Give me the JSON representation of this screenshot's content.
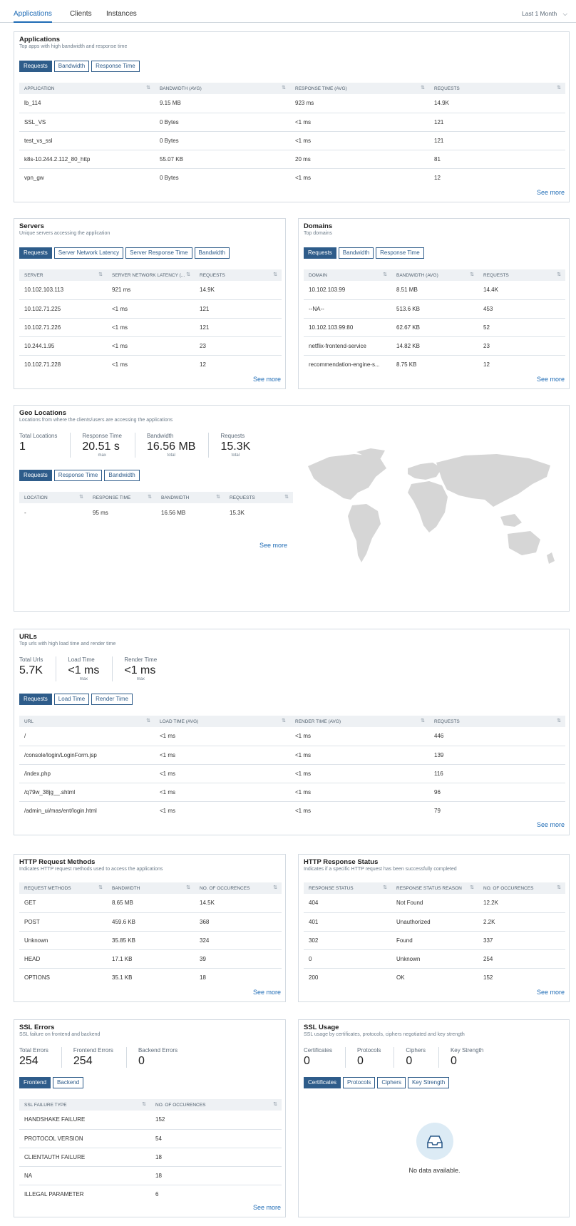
{
  "topnav": {
    "tabs": [
      "Applications",
      "Clients",
      "Instances"
    ],
    "period": "Last 1 Month"
  },
  "applications": {
    "title": "Applications",
    "subtitle": "Top apps with high bandwidth and response time",
    "buttons": [
      "Requests",
      "Bandwidth",
      "Response Time"
    ],
    "headers": [
      "APPLICATION",
      "BANDWIDTH (AVG)",
      "RESPONSE TIME (AVG)",
      "REQUESTS"
    ],
    "rows": [
      [
        "lb_114",
        "9.15 MB",
        "923 ms",
        "14.9K"
      ],
      [
        "SSL_VS",
        "0 Bytes",
        "<1 ms",
        "121"
      ],
      [
        "test_vs_ssl",
        "0 Bytes",
        "<1 ms",
        "121"
      ],
      [
        "k8s-10.244.2.112_80_http",
        "55.07 KB",
        "20 ms",
        "81"
      ],
      [
        "vpn_gw",
        "0 Bytes",
        "<1 ms",
        "12"
      ]
    ],
    "see_more": "See more"
  },
  "servers": {
    "title": "Servers",
    "subtitle": "Unique servers accessing the application",
    "buttons": [
      "Requests",
      "Server Network Latency",
      "Server Response Time",
      "Bandwidth"
    ],
    "headers": [
      "SERVER",
      "SERVER NETWORK LATENCY (...",
      "REQUESTS"
    ],
    "rows": [
      [
        "10.102.103.113",
        "921 ms",
        "14.9K"
      ],
      [
        "10.102.71.225",
        "<1 ms",
        "121"
      ],
      [
        "10.102.71.226",
        "<1 ms",
        "121"
      ],
      [
        "10.244.1.95",
        "<1 ms",
        "23"
      ],
      [
        "10.102.71.228",
        "<1 ms",
        "12"
      ]
    ],
    "see_more": "See more"
  },
  "domains": {
    "title": "Domains",
    "subtitle": "Top domains",
    "buttons": [
      "Requests",
      "Bandwidth",
      "Response Time"
    ],
    "headers": [
      "DOMAIN",
      "BANDWIDTH (AVG)",
      "REQUESTS"
    ],
    "rows": [
      [
        "10.102.103.99",
        "8.51 MB",
        "14.4K"
      ],
      [
        "--NA--",
        "513.6 KB",
        "453"
      ],
      [
        "10.102.103.99:80",
        "62.67 KB",
        "52"
      ],
      [
        "netflix-frontend-service",
        "14.82 KB",
        "23"
      ],
      [
        "recommendation-engine-s...",
        "8.75 KB",
        "12"
      ]
    ],
    "see_more": "See more"
  },
  "geo": {
    "title": "Geo Locations",
    "subtitle": "Locations from where the clients/users are accessing the applications",
    "stats": [
      {
        "label": "Total Locations",
        "value": "1",
        "sub": ""
      },
      {
        "label": "Response Time",
        "value": "20.51 s",
        "sub": "max"
      },
      {
        "label": "Bandwidth",
        "value": "16.56 MB",
        "sub": "total"
      },
      {
        "label": "Requests",
        "value": "15.3K",
        "sub": "total"
      }
    ],
    "buttons": [
      "Requests",
      "Response Time",
      "Bandwidth"
    ],
    "headers": [
      "LOCATION",
      "RESPONSE TIME",
      "BANDWIDTH",
      "REQUESTS"
    ],
    "rows": [
      [
        "-",
        "95 ms",
        "16.56 MB",
        "15.3K"
      ]
    ],
    "see_more": "See more",
    "map_color": "#d6d6d6"
  },
  "urls": {
    "title": "URLs",
    "subtitle": "Top urls with high load time and render time",
    "stats": [
      {
        "label": "Total Urls",
        "value": "5.7K",
        "sub": ""
      },
      {
        "label": "Load Time",
        "value": "<1 ms",
        "sub": "max"
      },
      {
        "label": "Render Time",
        "value": "<1 ms",
        "sub": "max"
      }
    ],
    "buttons": [
      "Requests",
      "Load Time",
      "Render Time"
    ],
    "headers": [
      "URL",
      "LOAD TIME (AVG)",
      "RENDER TIME (AVG)",
      "REQUESTS"
    ],
    "rows": [
      [
        "/",
        "<1 ms",
        "<1 ms",
        "446"
      ],
      [
        "/console/login/LoginForm.jsp",
        "<1 ms",
        "<1 ms",
        "139"
      ],
      [
        "/index.php",
        "<1 ms",
        "<1 ms",
        "116"
      ],
      [
        "/q79w_38jg__.shtml",
        "<1 ms",
        "<1 ms",
        "96"
      ],
      [
        "/admin_ui/mas/ent/login.html",
        "<1 ms",
        "<1 ms",
        "79"
      ]
    ],
    "see_more": "See more"
  },
  "http_methods": {
    "title": "HTTP Request Methods",
    "subtitle": "Indicates HTTP request methods used to access the applications",
    "headers": [
      "REQUEST METHODS",
      "BANDWIDTH",
      "NO. OF OCCURENCES"
    ],
    "rows": [
      [
        "GET",
        "8.65 MB",
        "14.5K"
      ],
      [
        "POST",
        "459.6 KB",
        "368"
      ],
      [
        "Unknown",
        "35.85 KB",
        "324"
      ],
      [
        "HEAD",
        "17.1 KB",
        "39"
      ],
      [
        "OPTIONS",
        "35.1 KB",
        "18"
      ]
    ],
    "see_more": "See more"
  },
  "http_status": {
    "title": "HTTP Response Status",
    "subtitle": "Indicates if a specific HTTP request has been successfully completed",
    "headers": [
      "RESPONSE STATUS",
      "RESPONSE STATUS REASON",
      "NO. OF OCCURENCES"
    ],
    "rows": [
      [
        "404",
        "Not Found",
        "12.2K"
      ],
      [
        "401",
        "Unauthorized",
        "2.2K"
      ],
      [
        "302",
        "Found",
        "337"
      ],
      [
        "0",
        "Unknown",
        "254"
      ],
      [
        "200",
        "OK",
        "152"
      ]
    ],
    "see_more": "See more"
  },
  "ssl_errors": {
    "title": "SSL Errors",
    "subtitle": "SSL failure on frontend and backend",
    "stats": [
      {
        "label": "Total Errors",
        "value": "254",
        "sub": ""
      },
      {
        "label": "Frontend Errors",
        "value": "254",
        "sub": ""
      },
      {
        "label": "Backend Errors",
        "value": "0",
        "sub": ""
      }
    ],
    "buttons": [
      "Frontend",
      "Backend"
    ],
    "headers": [
      "SSL FAILURE TYPE",
      "NO. OF OCCURENCES"
    ],
    "rows": [
      [
        "HANDSHAKE FAILURE",
        "152"
      ],
      [
        "PROTOCOL VERSION",
        "54"
      ],
      [
        "CLIENTAUTH FAILURE",
        "18"
      ],
      [
        "NA",
        "18"
      ],
      [
        "ILLEGAL PARAMETER",
        "6"
      ]
    ],
    "see_more": "See more"
  },
  "ssl_usage": {
    "title": "SSL Usage",
    "subtitle": "SSL usage by certificates, protocols, ciphers negotiated and key strength",
    "stats": [
      {
        "label": "Certificates",
        "value": "0",
        "sub": ""
      },
      {
        "label": "Protocols",
        "value": "0",
        "sub": ""
      },
      {
        "label": "Ciphers",
        "value": "0",
        "sub": ""
      },
      {
        "label": "Key Strength",
        "value": "0",
        "sub": ""
      }
    ],
    "buttons": [
      "Certificates",
      "Protocols",
      "Ciphers",
      "Key Strength"
    ],
    "empty": "No data available."
  }
}
